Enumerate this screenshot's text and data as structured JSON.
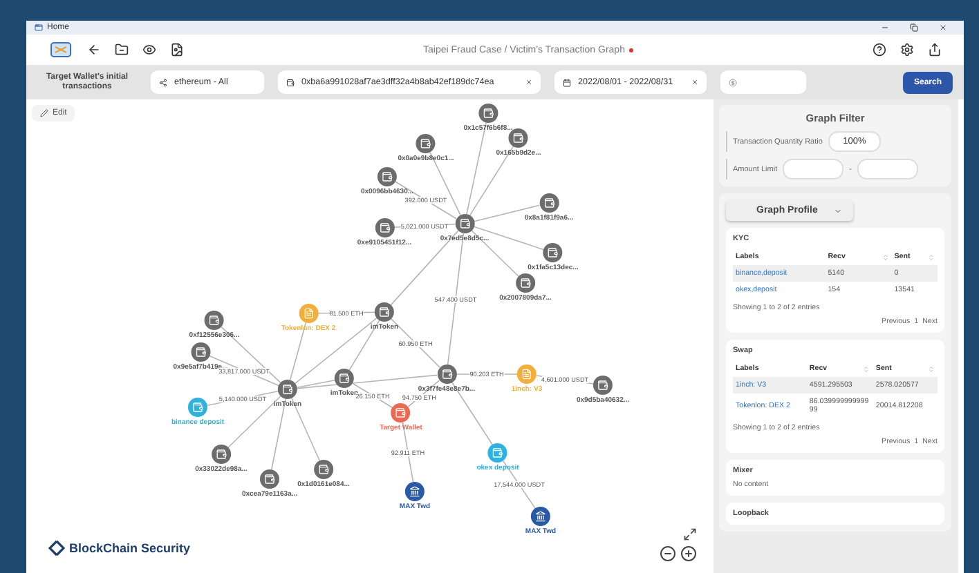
{
  "window": {
    "title": "Home"
  },
  "header": {
    "title": "Taipei Fraud Case / Victim's Transaction Graph",
    "unsaved": true
  },
  "query": {
    "label": "Target Wallet's initial transactions",
    "chain": "ethereum - All",
    "address": "0xba6a991028af7ae3dff32a4b8ab42ef189dc74ea",
    "dates": "2022/08/01 - 2022/08/31",
    "search": "Search"
  },
  "edit": "Edit",
  "graph": {
    "nodes": [
      {
        "kind": "wallet",
        "label": "0x0a0e9b8e0c1..."
      },
      {
        "kind": "wallet",
        "label": "0x0096bb4630..."
      },
      {
        "kind": "wallet",
        "label": "0x1c57f6b6f8..."
      },
      {
        "kind": "wallet",
        "label": "0x165b9d2e..."
      },
      {
        "kind": "wallet",
        "label": "0x8a1f81f9a6..."
      },
      {
        "kind": "wallet",
        "label": "0x1fa5c13dec..."
      },
      {
        "kind": "wallet",
        "label": "0x2007809da7..."
      },
      {
        "kind": "wallet",
        "label": "0xe9105451f12..."
      },
      {
        "kind": "wallet",
        "label": "0x7ed5e8d5c..."
      },
      {
        "kind": "dex",
        "label": "Tokenlon: DEX 2"
      },
      {
        "kind": "wallet",
        "label": "imToken"
      },
      {
        "kind": "wallet",
        "label": "0xf12556e306..."
      },
      {
        "kind": "wallet",
        "label": "0x9e5af7b419e..."
      },
      {
        "kind": "wallet",
        "label": "imToken"
      },
      {
        "kind": "wallet",
        "label": "imToken"
      },
      {
        "kind": "exchange",
        "label": "binance deposit"
      },
      {
        "kind": "wallet",
        "label": "0x33022de98a..."
      },
      {
        "kind": "wallet",
        "label": "0xcea79e1163a..."
      },
      {
        "kind": "wallet",
        "label": "0x1d0161e084..."
      },
      {
        "kind": "target",
        "label": "Target Wallet"
      },
      {
        "kind": "bank",
        "label": "MAX Twd"
      },
      {
        "kind": "wallet",
        "label": "0x3f7fe48e8e7b..."
      },
      {
        "kind": "dex",
        "label": "1inch: V3"
      },
      {
        "kind": "wallet",
        "label": "0x9d5ba40632..."
      },
      {
        "kind": "exchange",
        "label": "okex deposit"
      },
      {
        "kind": "bank",
        "label": "MAX Twd"
      }
    ],
    "edge_labels": [
      "392.000 USDT",
      "5,021.000 USDT",
      "547.400 USDT",
      "81.500 ETH",
      "60.950 ETH",
      "33,817.000 USDT",
      "5,140.000 USDT",
      "26.150 ETH",
      "94.750 ETH",
      "92.911 ETH",
      "90.203 ETH",
      "4,601.000 USDT",
      "17,544.000 USDT"
    ]
  },
  "graph_filter": {
    "title": "Graph Filter",
    "ratio_label": "Transaction Quantity Ratio",
    "ratio": "100%",
    "amount_label": "Amount Limit",
    "separator": "-"
  },
  "profile": {
    "dropdown": "Graph Profile",
    "sections": [
      {
        "kind": "table",
        "title": "KYC",
        "columns": [
          "Labels",
          "Recv",
          "Sent"
        ],
        "rows": [
          [
            "binance,deposit",
            "5140",
            "0"
          ],
          [
            "okex,deposit",
            "154",
            "13541"
          ]
        ],
        "info": "Showing 1 to 2 of 2 entries",
        "pager": [
          "Previous",
          "1",
          "Next"
        ]
      },
      {
        "kind": "table",
        "title": "Swap",
        "columns": [
          "Labels",
          "Recv",
          "Sent"
        ],
        "rows": [
          [
            "1inch: V3",
            "4591.295503",
            "2578.020577"
          ],
          [
            "Tokenlon: DEX 2",
            "86.03999999999999",
            "20014.812208"
          ]
        ],
        "info": "Showing 1 to 2 of 2 entries",
        "pager": [
          "Previous",
          "1",
          "Next"
        ]
      },
      {
        "kind": "empty",
        "title": "Mixer",
        "text": "No content"
      },
      {
        "kind": "title",
        "title": "Loopback"
      }
    ]
  },
  "logo": "BlockChain Security"
}
